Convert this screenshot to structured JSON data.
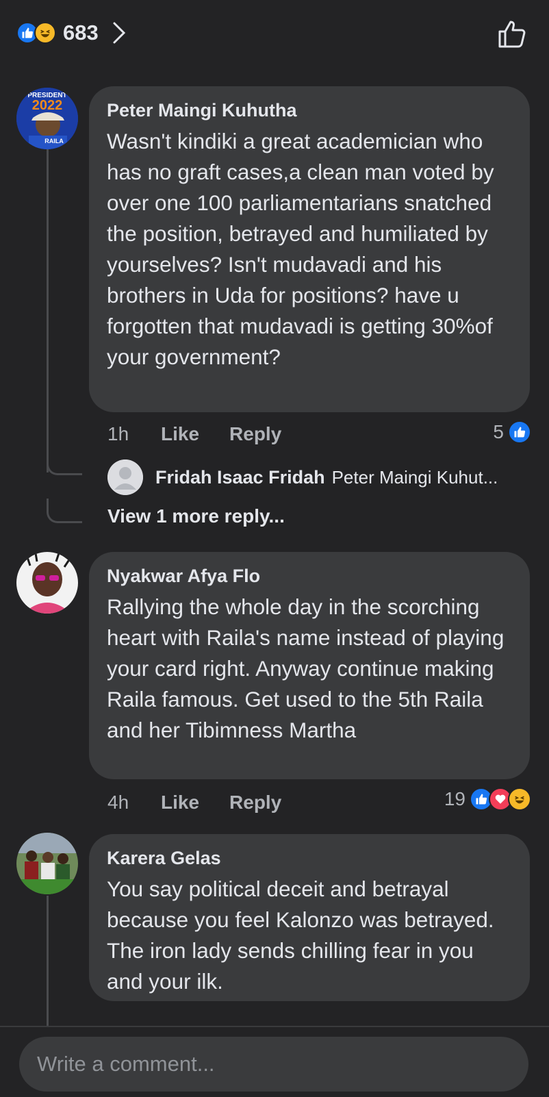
{
  "header": {
    "reaction_count": "683",
    "reaction_icons": [
      "like-icon",
      "haha-icon"
    ]
  },
  "comments": [
    {
      "author": "Peter Maingi Kuhutha",
      "avatar_text": [
        "PRESIDENT",
        "2022",
        "RAILA"
      ],
      "text": "Wasn't kindiki a great academician who has no graft cases,a clean man voted by over one 100 parliamentarians snatched the position, betrayed and humiliated by yourselves? Isn't mudavadi and his brothers in Uda for positions? have u forgotten that mudavadi is getting 30%of your government?",
      "time": "1h",
      "like_label": "Like",
      "reply_label": "Reply",
      "reaction_count": "5",
      "reply": {
        "author": "Fridah Isaac Fridah",
        "preview": "Peter Maingi Kuhut..."
      },
      "view_more": "View 1 more reply..."
    },
    {
      "author": "Nyakwar Afya Flo",
      "text": "Rallying  the whole day  in the scorching  heart with Raila's name instead  of  playing  your card right. Anyway continue  making Raila famous.  Get used to the 5th Raila and her Tibimness Martha",
      "time": "4h",
      "like_label": "Like",
      "reply_label": "Reply",
      "reaction_count": "19"
    },
    {
      "author": "Karera Gelas",
      "text": "You say political deceit and betrayal because you feel Kalonzo was betrayed. The iron lady sends chilling fear in you and your ilk."
    }
  ],
  "composer": {
    "placeholder": "Write a comment..."
  },
  "colors": {
    "background": "#232325",
    "bubble": "#3a3b3d",
    "like_blue": "#1877f2",
    "love_red": "#f33e58",
    "haha_yellow": "#f7b928"
  }
}
